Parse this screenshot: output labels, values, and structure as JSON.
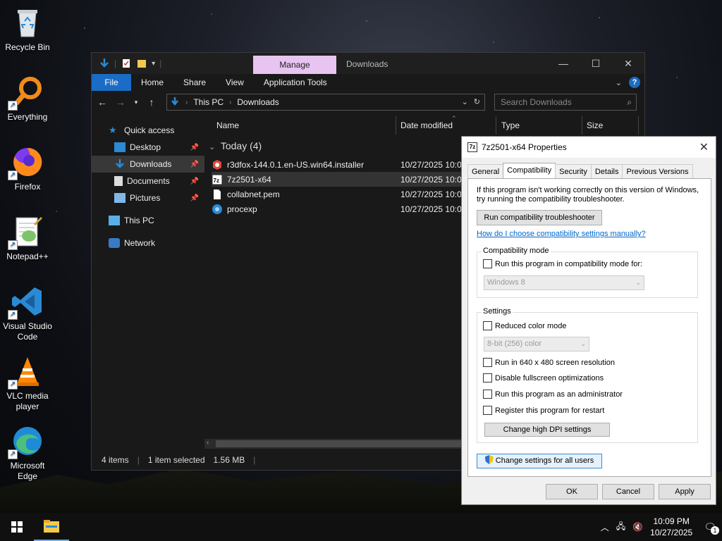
{
  "desktop": {
    "icons": [
      {
        "label": "Recycle Bin",
        "icon": "recycle-bin-icon"
      },
      {
        "label": "Everything",
        "icon": "everything-search-icon"
      },
      {
        "label": "Firefox",
        "icon": "firefox-icon"
      },
      {
        "label": "Notepad++",
        "icon": "notepad-plus-plus-icon"
      },
      {
        "label": "Visual Studio Code",
        "icon": "vscode-icon"
      },
      {
        "label": "VLC media player",
        "icon": "vlc-icon"
      },
      {
        "label": "Microsoft Edge",
        "icon": "edge-icon"
      }
    ]
  },
  "explorer": {
    "title": "Downloads",
    "manage_tab": "Manage",
    "ribbon_tabs": [
      "File",
      "Home",
      "Share",
      "View",
      "Application Tools"
    ],
    "address": {
      "part1": "This PC",
      "part2": "Downloads"
    },
    "search_placeholder": "Search Downloads",
    "nav": [
      {
        "label": "Quick access",
        "icon": "star-icon",
        "pinned": false
      },
      {
        "label": "Desktop",
        "icon": "desktop-folder-icon",
        "pinned": true
      },
      {
        "label": "Downloads",
        "icon": "downloads-folder-icon",
        "pinned": true,
        "selected": true
      },
      {
        "label": "Documents",
        "icon": "documents-folder-icon",
        "pinned": true
      },
      {
        "label": "Pictures",
        "icon": "pictures-folder-icon",
        "pinned": true
      },
      {
        "label": "This PC",
        "icon": "this-pc-icon",
        "pinned": false
      },
      {
        "label": "Network",
        "icon": "network-icon",
        "pinned": false
      }
    ],
    "columns": {
      "name": "Name",
      "date": "Date modified",
      "type": "Type",
      "size": "Size"
    },
    "group": "Today (4)",
    "files": [
      {
        "name": "r3dfox-144.0.1.en-US.win64.installer",
        "date": "10/27/2025 10:06",
        "icon": "installer-icon"
      },
      {
        "name": "7z2501-x64",
        "date": "10/27/2025 10:06",
        "icon": "7zip-icon",
        "selected": true
      },
      {
        "name": "collabnet.pem",
        "date": "10/27/2025 10:06",
        "icon": "file-icon"
      },
      {
        "name": "procexp",
        "date": "10/27/2025 10:05",
        "icon": "procexp-icon"
      }
    ],
    "status": {
      "items": "4 items",
      "selected": "1 item selected",
      "size": "1.56 MB"
    }
  },
  "dialog": {
    "title": "7z2501-x64 Properties",
    "title_icon_text": "7z",
    "tabs": [
      "General",
      "Compatibility",
      "Security",
      "Details",
      "Previous Versions"
    ],
    "intro": "If this program isn't working correctly on this version of Windows, try running the compatibility troubleshooter.",
    "troubleshooter_btn": "Run compatibility troubleshooter",
    "help_link": "How do I choose compatibility settings manually?",
    "compat_legend": "Compatibility mode",
    "compat_check": "Run this program in compatibility mode for:",
    "compat_select": "Windows 8",
    "settings_legend": "Settings",
    "reduced_color": "Reduced color mode",
    "color_select": "8-bit (256) color",
    "res_640": "Run in 640 x 480 screen resolution",
    "disable_fullscreen": "Disable fullscreen optimizations",
    "run_admin": "Run this program as an administrator",
    "register_restart": "Register this program for restart",
    "dpi_btn": "Change high DPI settings",
    "all_users_btn": "Change settings for all users",
    "ok": "OK",
    "cancel": "Cancel",
    "apply": "Apply"
  },
  "taskbar": {
    "time": "10:09 PM",
    "date": "10/27/2025",
    "notif_count": "1"
  }
}
